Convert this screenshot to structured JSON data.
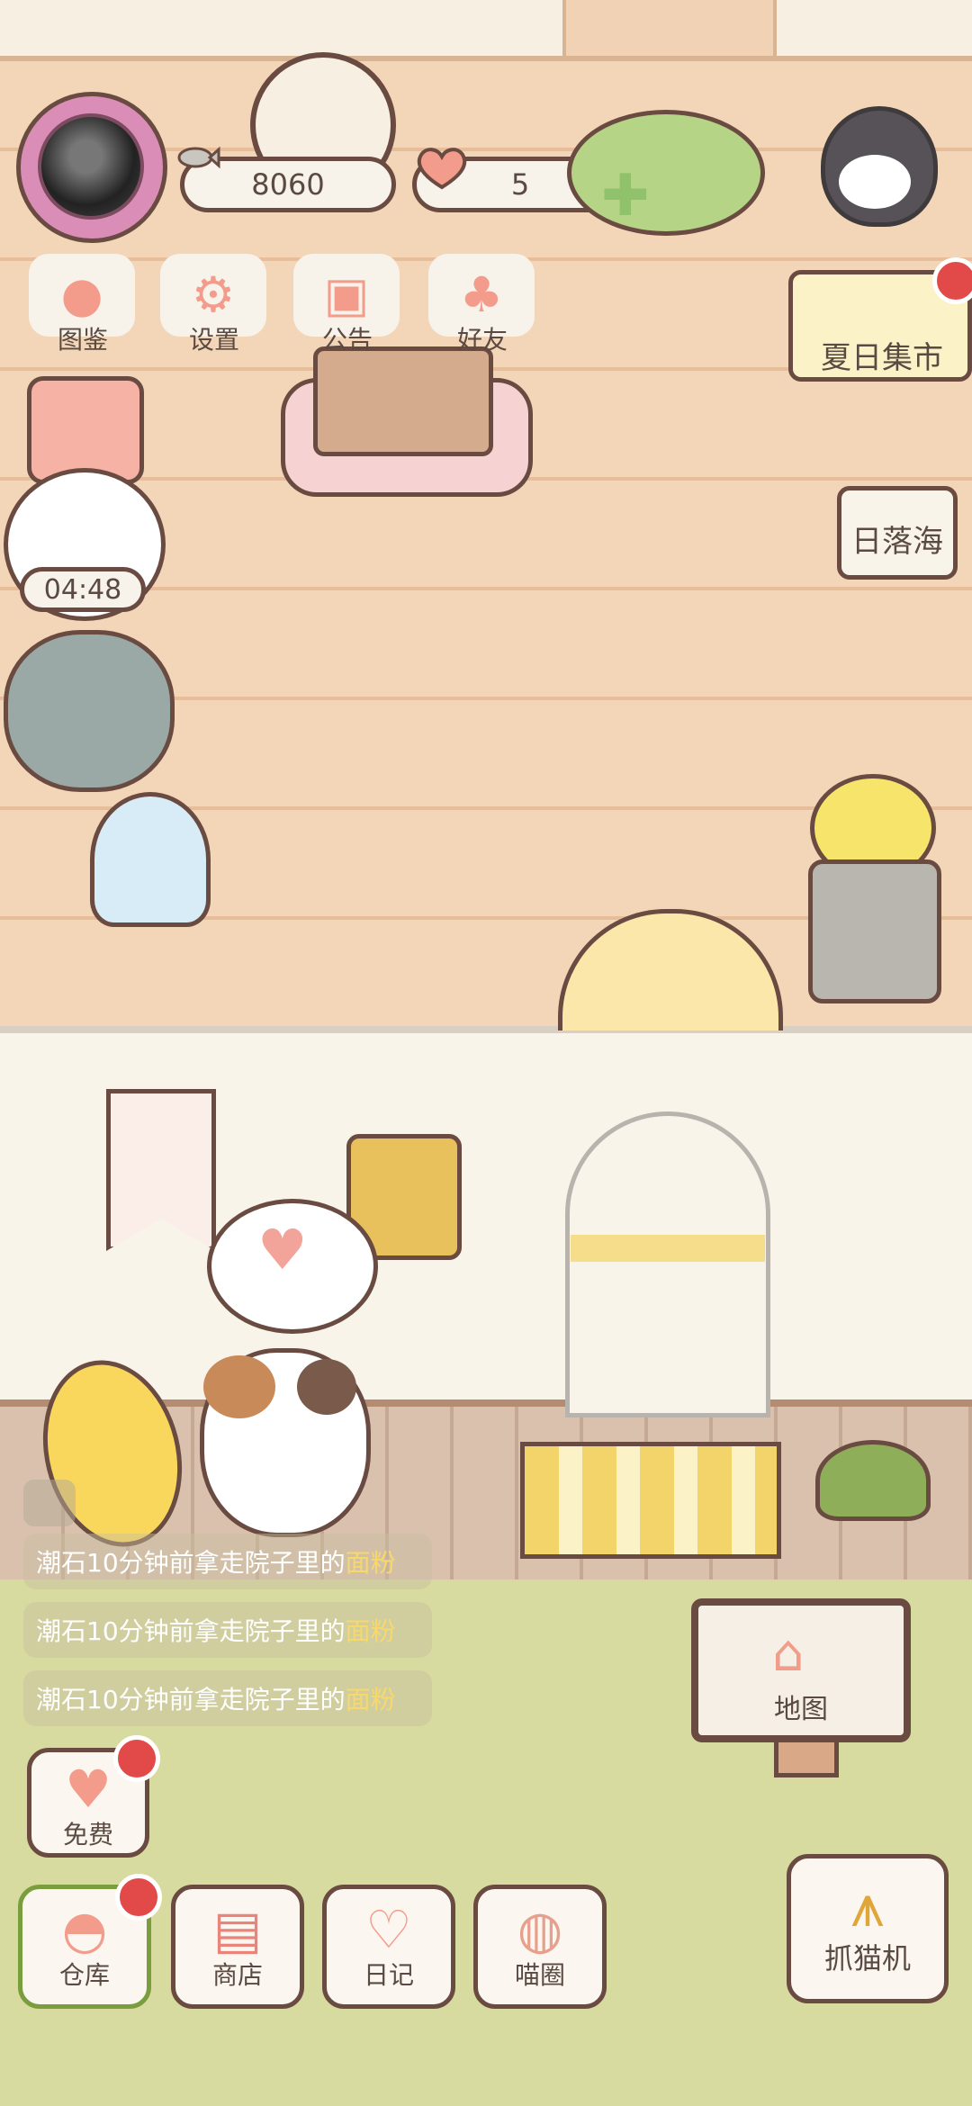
{
  "hud": {
    "coins": "8060",
    "hearts": "5",
    "timer": "04:48"
  },
  "top_menu": [
    {
      "label": "图鉴",
      "icon": "cat-face-icon"
    },
    {
      "label": "设置",
      "icon": "gear-icon"
    },
    {
      "label": "公告",
      "icon": "gift-icon"
    },
    {
      "label": "好友",
      "icon": "friends-icon"
    }
  ],
  "right_side": {
    "event_label": "夏日集市",
    "sunset_label": "日落海"
  },
  "messages": [
    {
      "prefix": "潮石10分钟前拿走院子里的",
      "item": "面粉"
    },
    {
      "prefix": "潮石10分钟前拿走院子里的",
      "item": "面粉"
    },
    {
      "prefix": "潮石10分钟前拿走院子里的",
      "item": "面粉"
    }
  ],
  "map_sign": {
    "label": "地图",
    "icon": "house-icon"
  },
  "free_button": {
    "label": "免费",
    "icon": "heart-icon"
  },
  "bottom_nav": [
    {
      "label": "仓库",
      "icon": "basket-icon"
    },
    {
      "label": "商店",
      "icon": "shop-icon"
    },
    {
      "label": "日记",
      "icon": "diary-icon"
    },
    {
      "label": "喵圈",
      "icon": "cat-planet-icon"
    }
  ],
  "claw_button": {
    "label": "抓猫机",
    "icon": "claw-icon"
  },
  "colors": {
    "outline": "#6a4b41",
    "accent_pink": "#f39c8c",
    "badge_red": "#e24a4a",
    "floor": "#f3d5b7",
    "yard": "#d8db9f"
  }
}
